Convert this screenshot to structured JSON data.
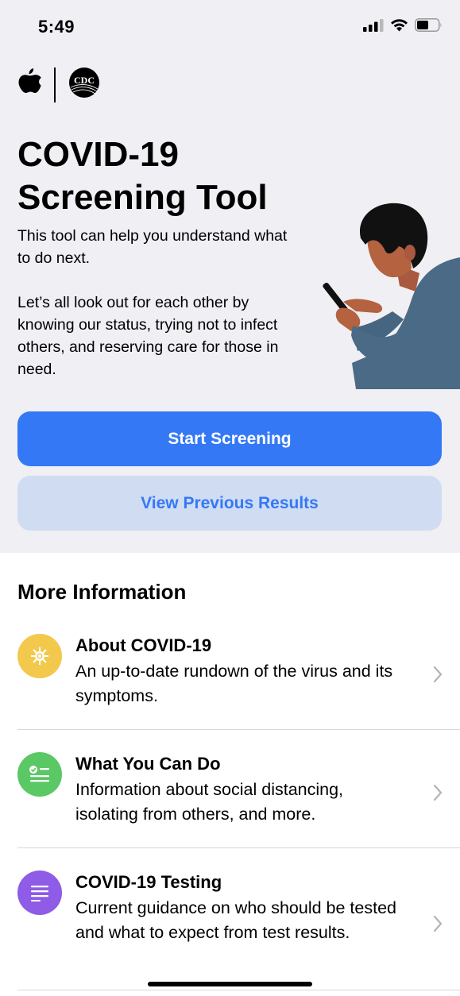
{
  "status_bar": {
    "time": "5:49"
  },
  "header": {
    "logo_cdc": "CDC",
    "title": "COVID-19 Screening Tool",
    "intro": "This tool can help you understand what to do next.",
    "body": "Let’s all look out for each other by knowing our status, trying not to infect others, and reserving care for those in need."
  },
  "buttons": {
    "start": "Start Screening",
    "previous": "View Previous Results"
  },
  "more_info": {
    "title": "More Information",
    "items": [
      {
        "title": "About COVID-19",
        "desc": "An up-to-date rundown of the virus and its symptoms.",
        "icon": "virus-icon",
        "color": "#f2c94c"
      },
      {
        "title": "What You Can Do",
        "desc": "Information about social distancing, isolating from others, and more.",
        "icon": "checklist-icon",
        "color": "#5ac864"
      },
      {
        "title": "COVID-19 Testing",
        "desc": "Current guidance on who should be tested and what to expect from test results.",
        "icon": "document-lines-icon",
        "color": "#8e5ce6"
      }
    ]
  },
  "colors": {
    "accent": "#3478f6",
    "secondary_bg": "#d0dcf2",
    "header_bg": "#efeff4"
  }
}
